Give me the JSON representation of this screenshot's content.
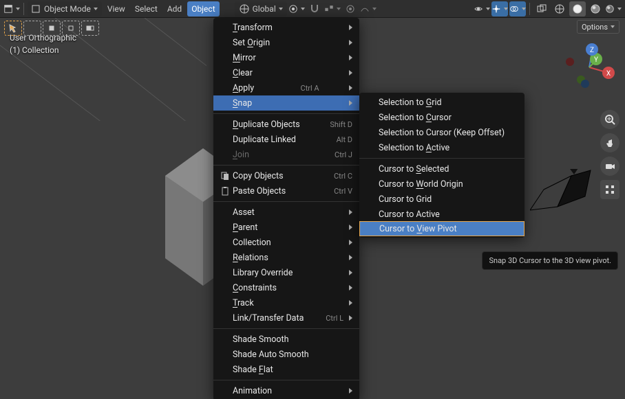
{
  "header": {
    "mode_label": "Object Mode",
    "menus": [
      "View",
      "Select",
      "Add",
      "Object"
    ],
    "active_menu": "Object",
    "orientation_label": "Global"
  },
  "options_label": "Options",
  "overlay": {
    "line1": "User Orthographic",
    "line2": "(1) Collection"
  },
  "object_menu": {
    "groups": [
      [
        {
          "label": "Transform",
          "submenu": true,
          "underline": 0
        },
        {
          "label": "Set Origin",
          "submenu": true,
          "underline": 4
        },
        {
          "label": "Mirror",
          "submenu": true,
          "underline": 0
        },
        {
          "label": "Clear",
          "submenu": true,
          "underline": 0
        },
        {
          "label": "Apply",
          "shortcut": "Ctrl A",
          "submenu": true,
          "underline": 0
        },
        {
          "label": "Snap",
          "submenu": true,
          "highlight": true,
          "underline": 0
        }
      ],
      [
        {
          "label": "Duplicate Objects",
          "shortcut": "Shift D",
          "underline": 0
        },
        {
          "label": "Duplicate Linked",
          "shortcut": "Alt D"
        },
        {
          "label": "Join",
          "shortcut": "Ctrl J",
          "disabled": true,
          "underline": 0
        }
      ],
      [
        {
          "icon": "copy",
          "label": "Copy Objects",
          "shortcut": "Ctrl C"
        },
        {
          "icon": "paste",
          "label": "Paste Objects",
          "shortcut": "Ctrl V"
        }
      ],
      [
        {
          "label": "Asset",
          "submenu": true
        },
        {
          "label": "Parent",
          "submenu": true,
          "underline": 0
        },
        {
          "label": "Collection",
          "submenu": true
        },
        {
          "label": "Relations",
          "submenu": true,
          "underline": 0
        },
        {
          "label": "Library Override",
          "submenu": true
        },
        {
          "label": "Constraints",
          "submenu": true,
          "underline": 0
        },
        {
          "label": "Track",
          "submenu": true,
          "underline": 0
        },
        {
          "label": "Link/Transfer Data",
          "shortcut": "Ctrl L",
          "submenu": true
        }
      ],
      [
        {
          "label": "Shade Smooth"
        },
        {
          "label": "Shade Auto Smooth"
        },
        {
          "label": "Shade Flat",
          "underline": 6
        }
      ],
      [
        {
          "label": "Animation",
          "submenu": true
        }
      ]
    ]
  },
  "snap_menu": {
    "groups": [
      [
        {
          "label": "Selection to Grid",
          "underline": 13
        },
        {
          "label": "Selection to Cursor",
          "underline": 13
        },
        {
          "label": "Selection to Cursor (Keep Offset)"
        },
        {
          "label": "Selection to Active",
          "underline": 13
        }
      ],
      [
        {
          "label": "Cursor to Selected",
          "underline": 10
        },
        {
          "label": "Cursor to World Origin",
          "underline": 10
        },
        {
          "label": "Cursor to Grid"
        },
        {
          "label": "Cursor to Active"
        },
        {
          "label": "Cursor to View Pivot",
          "highlight2": true,
          "underline": 10
        }
      ]
    ]
  },
  "tooltip": "Snap 3D Cursor to the 3D view pivot.",
  "gizmo": {
    "x": "X",
    "y": "Y",
    "z": "Z"
  },
  "icons": {
    "editor_type": "editor-type-icon",
    "mode": "object-mode-icon",
    "orientation": "orientation-icon",
    "pivot": "pivot-icon",
    "snap": "snap-icon",
    "snap_opts": "snap-options-icon",
    "proportional": "proportional-icon",
    "falloff": "falloff-icon",
    "visibility": "visibility-icon",
    "gizmo_t": "gizmo-toggle-icon",
    "overlay_t": "overlay-toggle-icon",
    "xray": "xray-icon",
    "shade1": "wireframe-shading-icon",
    "shade2": "solid-shading-icon",
    "shade3": "matprev-shading-icon",
    "shade4": "rendered-shading-icon"
  }
}
